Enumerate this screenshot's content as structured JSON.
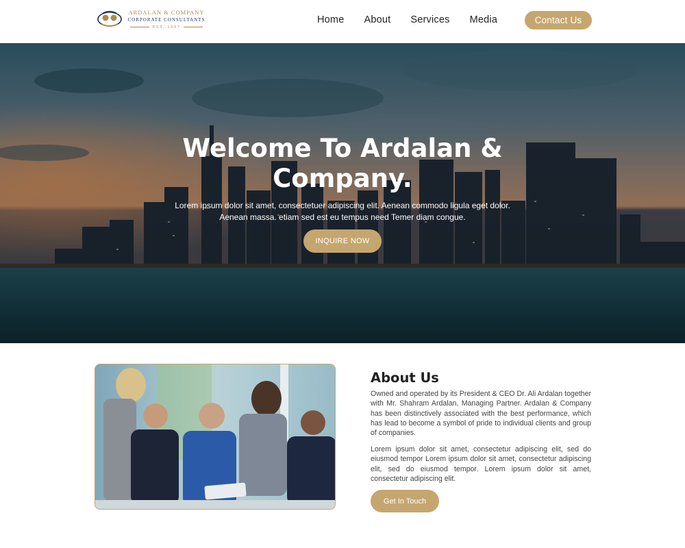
{
  "brand": {
    "name": "ARDALAN & COMPANY",
    "tagline": "CORPORATE CONSULTANTS",
    "established": "EST. 1997"
  },
  "nav": {
    "items": [
      "Home",
      "About",
      "Services",
      "Media"
    ],
    "contact_label": "Contact Us"
  },
  "hero": {
    "title_line1": "Welcome To Ardalan &",
    "title_line2": "Company.",
    "text": "Lorem ipsum dolor sit amet, consectetuer adipiscing elit. Aenean commodo ligula eget dolor. Aenean massa. etiam sed est eu tempus need Temer diam congue.",
    "button_label": "INQUIRE NOW"
  },
  "about": {
    "title": "About Us",
    "paragraph1": "Owned and operated by its President & CEO Dr. Ali Ardalan together with Mr. Shahram Ardalan, Managing Partner. Ardalan & Company has been distinctively associated with the best performance, which has lead to become a symbol of pride to individual clients and group of companies.",
    "paragraph2": "Lorem ipsum dolor sit amet, consectetur adipiscing elit, sed do eiusmod tempor Lorem ipsum dolor sit amet, consectetur adipiscing elit, sed do eiusmod tempor. Lorem ipsum dolor sit amet, consectetur adipiscing elit.",
    "button_label": "Get In Touch"
  },
  "colors": {
    "accent": "#c6a66f",
    "navy": "#1f2f5c"
  }
}
